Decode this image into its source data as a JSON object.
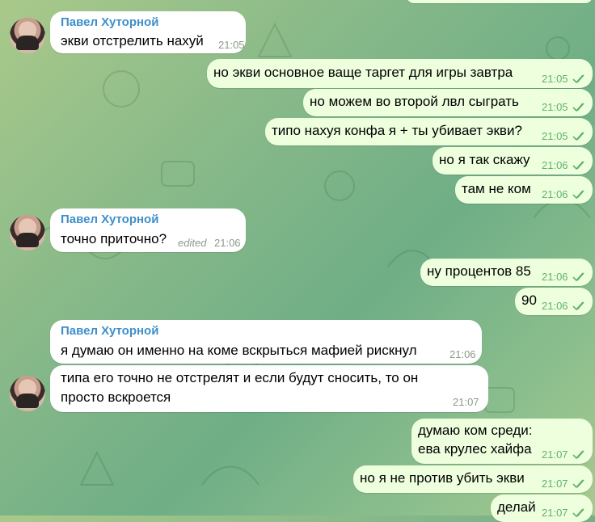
{
  "chat": {
    "sender_name": "Павел Хуторной",
    "messages": [
      {
        "text": "экви отстрелить нахуй",
        "time": "21:05"
      },
      {
        "text": "но экви основное ваще таргет для игры завтра",
        "time": "21:05"
      },
      {
        "text": "но можем во второй лвл сыграть",
        "time": "21:05"
      },
      {
        "text": "типо нахуя конфа я + ты убивает экви?",
        "time": "21:05"
      },
      {
        "text": "но я так скажу",
        "time": "21:06"
      },
      {
        "text": "там не ком",
        "time": "21:06"
      },
      {
        "text": "точно приточно?",
        "time": "21:06",
        "edited_label": "edited"
      },
      {
        "text": "ну процентов 85",
        "time": "21:06"
      },
      {
        "text": "90",
        "time": "21:06"
      },
      {
        "text": "я думаю он именно на коме вскрыться мафией рискнул",
        "time": "21:06"
      },
      {
        "line1": "типа его точно не отстрелят и если будут сносить, то он",
        "line2": "просто вскроется",
        "time": "21:07"
      },
      {
        "line1": "думаю ком среди:",
        "line2": "ева крулес хайфа",
        "time": "21:07"
      },
      {
        "text": "но я не против убить экви",
        "time": "21:07"
      },
      {
        "text": "делай",
        "time": "21:07"
      }
    ]
  },
  "colors": {
    "incoming_bubble": "#ffffff",
    "outgoing_bubble": "#eeffde",
    "sender_name": "#3d8fcb",
    "read_check": "#5fb26b"
  }
}
